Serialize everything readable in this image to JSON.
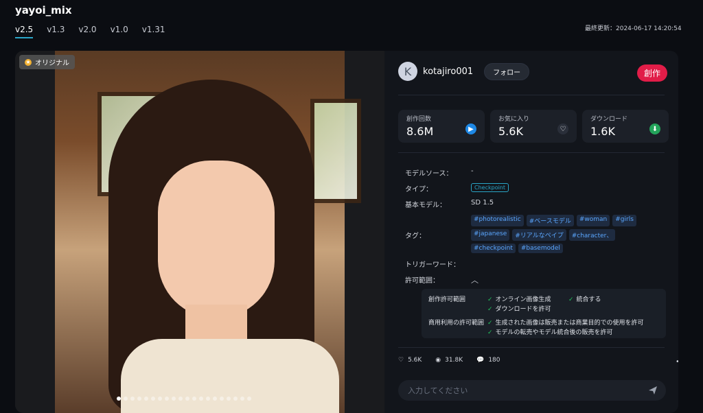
{
  "header": {
    "title": "yayoi_mix",
    "tabs": [
      {
        "label": "v2.5",
        "active": true
      },
      {
        "label": "v1.3"
      },
      {
        "label": "v2.0"
      },
      {
        "label": "v1.0"
      },
      {
        "label": "v1.31"
      }
    ],
    "updated": "最終更新：2024-06-17 14:20:54"
  },
  "gallery": {
    "badge": "オリジナル",
    "dots_count": 20,
    "active_dot": 1
  },
  "author": {
    "initial": "K",
    "name": "kotajiro001",
    "follow_label": "フォロー",
    "create_label": "創作"
  },
  "stats": [
    {
      "label": "創作回数",
      "value": "8.6M",
      "icon": "play-icon"
    },
    {
      "label": "お気に入り",
      "value": "5.6K",
      "icon": "heart-icon"
    },
    {
      "label": "ダウンロード",
      "value": "1.6K",
      "icon": "download-icon"
    }
  ],
  "info": {
    "model_source_label": "モデルソース：",
    "model_source_value": "-",
    "type_label": "タイプ：",
    "type_value": "Checkpoint",
    "base_model_label": "基本モデル：",
    "base_model_value": "SD 1.5",
    "tags_label": "タグ：",
    "tags": [
      "#photorealistic",
      "#ベースモデル",
      "#woman",
      "#girls",
      "#japanese",
      "#リアルなペイプ",
      "#character、",
      "#checkpoint",
      "#basemodel"
    ],
    "trigger_label": "トリガーワード：",
    "permission_label": "許可範囲："
  },
  "permissions": {
    "creation_label": "創作許可範囲",
    "creation_items": [
      "オンライン画像生成",
      "統合する",
      "ダウンロードを許可"
    ],
    "commercial_label": "商用利用の許可範囲",
    "commercial_items": [
      "生成された画像は販売または商業目的での使用を許可",
      "モデルの転売やモデル統合後の販売を許可"
    ]
  },
  "actions": {
    "likes": "5.6K",
    "views": "31.8K",
    "comments": "180"
  },
  "comment": {
    "placeholder": "入力してください"
  }
}
